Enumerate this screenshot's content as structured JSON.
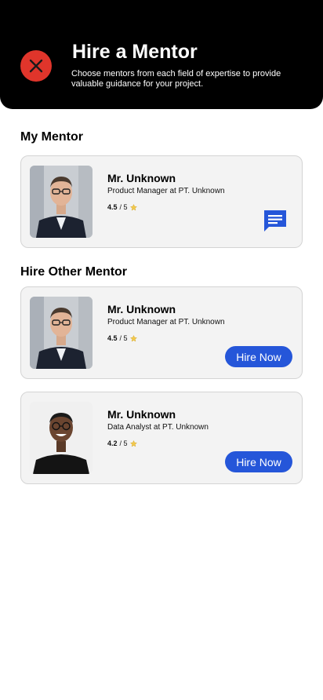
{
  "header": {
    "title": "Hire a Mentor",
    "subtitle": "Choose mentors from each field of expertise to provide valuable guidance for your project.",
    "close_icon": "close-icon",
    "close_color": "#e0352b"
  },
  "my_mentor": {
    "section_title": "My Mentor",
    "mentor": {
      "name": "Mr. Unknown",
      "role": "Product Manager at PT. Unknown",
      "rating": "4.5",
      "rating_max": "/ 5",
      "chat_icon": "chat-icon"
    }
  },
  "other_mentors": {
    "section_title": "Hire Other Mentor",
    "items": [
      {
        "name": "Mr. Unknown",
        "role": "Product Manager at PT. Unknown",
        "rating": "4.5",
        "rating_max": "/ 5",
        "button_label": "Hire Now"
      },
      {
        "name": "Mr. Unknown",
        "role": "Data Analyst at PT. Unknown",
        "rating": "4.2",
        "rating_max": "/ 5",
        "button_label": "Hire Now"
      }
    ]
  },
  "colors": {
    "accent": "#2556d9",
    "star": "#f2c94c"
  }
}
